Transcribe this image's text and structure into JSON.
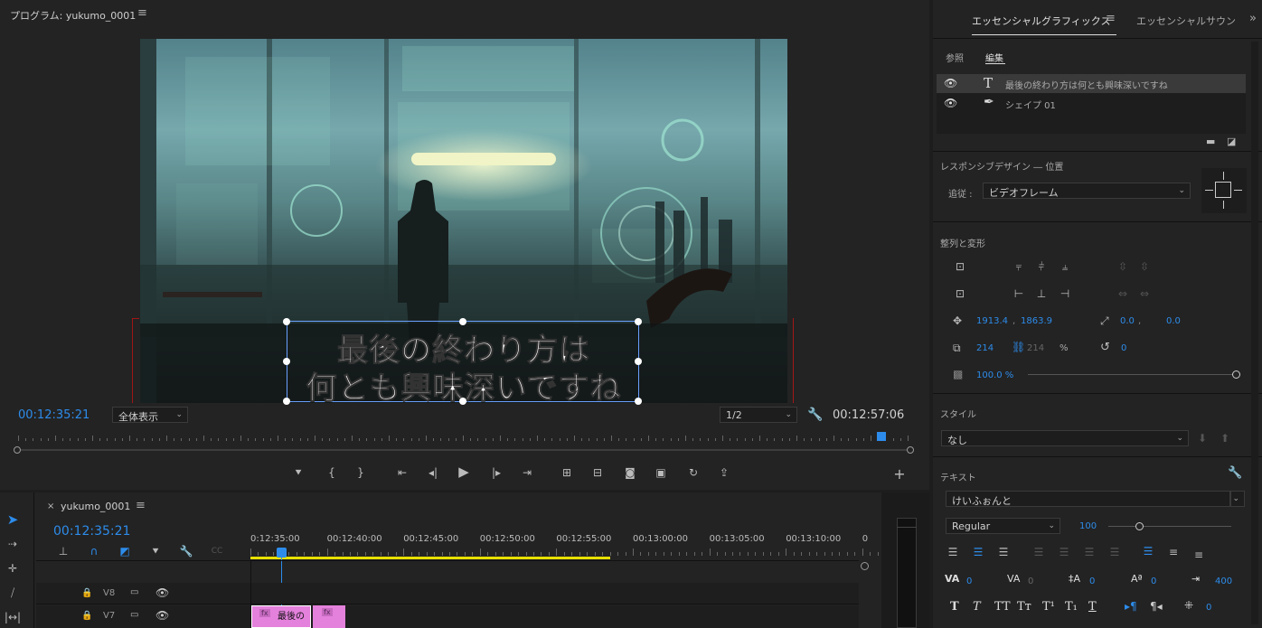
{
  "monitor": {
    "title": "プログラム: yukumo_0001",
    "timecode_left": "00:12:35:21",
    "timecode_right": "00:12:57:06",
    "zoom": "全体表示",
    "resolution": "1/2",
    "caption_line1": "最後の終わり方は",
    "caption_line2": "何とも興味深いですね",
    "playhead_fraction": 0.97
  },
  "timeline": {
    "tab": "yukumo_0001",
    "timecode": "00:12:35:21",
    "ruler": [
      "0:12:35:00",
      "00:12:40:00",
      "00:12:45:00",
      "00:12:50:00",
      "00:12:55:00",
      "00:13:00:00",
      "00:13:05:00",
      "00:13:10:00",
      "0"
    ],
    "tracks": [
      {
        "name": "V8"
      },
      {
        "name": "V7"
      }
    ],
    "clip_label": "最後の",
    "fx": "fx"
  },
  "panel": {
    "tab1": "エッセンシャルグラフィックス",
    "tab2": "エッセンシャルサウン",
    "sub_browse": "参照",
    "sub_edit": "編集",
    "layers": [
      {
        "name": "最後の終わり方は何とも興味深いですね"
      },
      {
        "name": "シェイプ 01"
      }
    ],
    "responsive_title": "レスポンシブデザイン ― 位置",
    "follow_label": "追従 :",
    "follow_value": "ビデオフレーム",
    "align_title": "整列と変形",
    "pos_x": "1913.4",
    "pos_y": "1863.9",
    "anchor_x": "0.0",
    "anchor_y": "0.0",
    "scale": "214",
    "scale2": "214",
    "scale_unit": "%",
    "rotation": "0",
    "opacity": "100.0 %",
    "style_title": "スタイル",
    "style_value": "なし",
    "text_title": "テキスト",
    "font": "けいふぉんと",
    "font_style": "Regular",
    "font_size": "100",
    "font_size_fraction": 0.25,
    "kerning": "0",
    "tracking": "0",
    "leading": "0",
    "baseline": "0",
    "tab_width": "400",
    "tsume": "0"
  },
  "colors": {
    "accent": "#2d8ceb",
    "clip": "#e481dc",
    "yellow": "#e8e000"
  }
}
